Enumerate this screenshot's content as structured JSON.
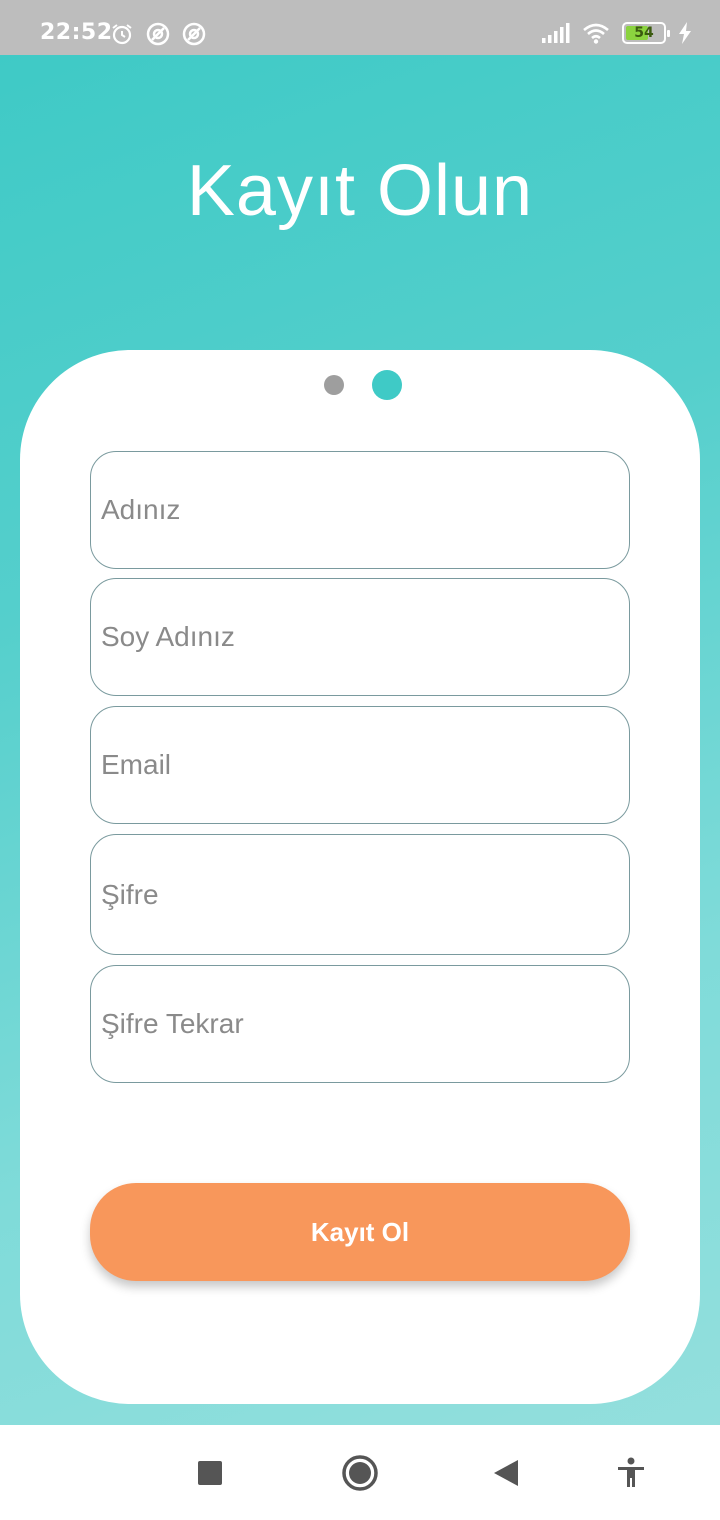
{
  "status_bar": {
    "time": "22:52",
    "battery_level": "54",
    "icons": [
      "alarm-icon",
      "vpn-icon",
      "vpn-icon",
      "signal-icon",
      "wifi-icon",
      "battery-icon",
      "charging-icon"
    ]
  },
  "page": {
    "title": "Kayıt Olun"
  },
  "pager": {
    "total_pages": 2,
    "active_page": 2
  },
  "form": {
    "first_name_placeholder": "Adınız",
    "last_name_placeholder": "Soy Adınız",
    "email_placeholder": "Email",
    "password_placeholder": "Şifre",
    "password_repeat_placeholder": "Şifre Tekrar",
    "submit_label": "Kayıt Ol"
  },
  "nav_bar": {
    "items": [
      "recents-icon",
      "home-icon",
      "back-icon",
      "accessibility-icon"
    ]
  },
  "colors": {
    "accent": "#3fcac6",
    "button": "#f8975b",
    "status_bar": "#bdbdbd"
  }
}
